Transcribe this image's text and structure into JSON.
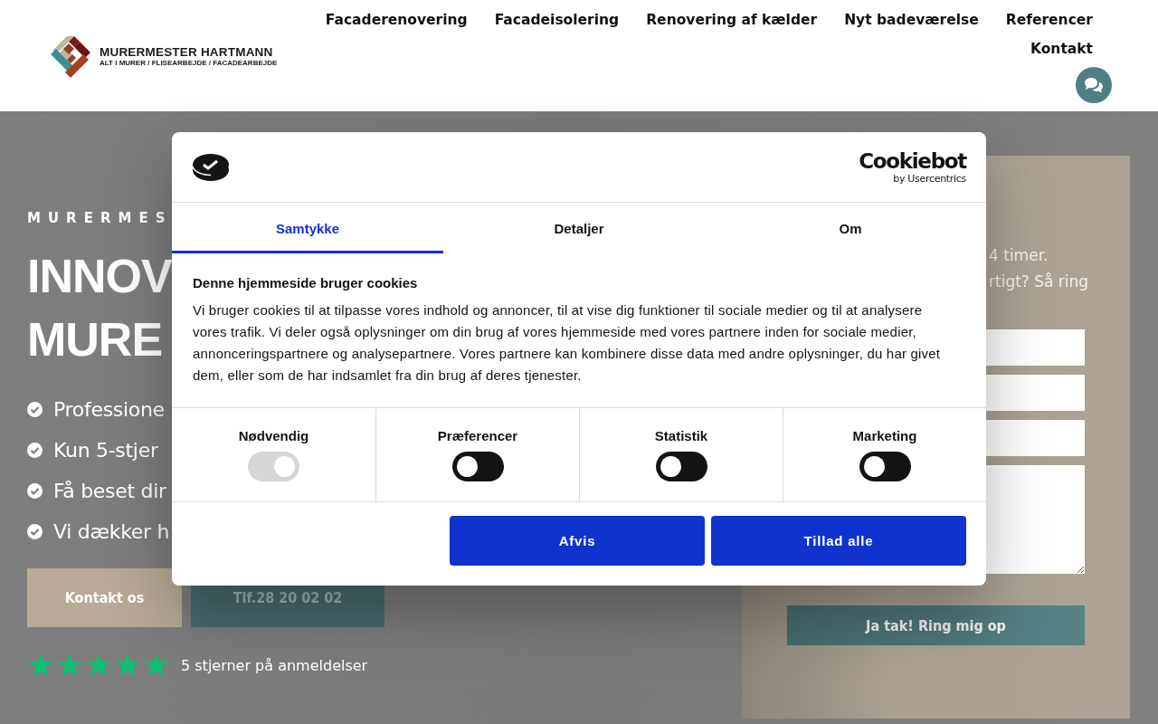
{
  "header": {
    "logo": {
      "name": "MURERMESTER HARTMANN",
      "tagline": "ALT I MURER / FLISEARBEJDE / FACADEARBEJDE"
    },
    "nav": [
      "Facaderenovering",
      "Facadeisolering",
      "Renovering af kælder",
      "Nyt badeværelse",
      "Referencer",
      "Kontakt"
    ]
  },
  "hero": {
    "eyebrow": "MURERMES",
    "heading_lines": [
      "INNOV",
      "MURE"
    ],
    "bullets": [
      "Professione",
      "Kun 5-stjer",
      "Få beset dir",
      "Vi dækker h"
    ],
    "buttons": [
      {
        "label": "Kontakt os",
        "kind": "primary"
      },
      {
        "label": "Tlf.28 20 02 02",
        "kind": "phone"
      }
    ],
    "rating": {
      "stars": 5,
      "text": "5 stjerner på anmeldelser"
    }
  },
  "callback_panel": {
    "intro_lines": [
      "4 timer.",
      "rtigt? Så ring"
    ],
    "fields": [
      {
        "kind": "input"
      },
      {
        "kind": "input"
      },
      {
        "kind": "input"
      },
      {
        "kind": "textarea"
      }
    ],
    "button": "Ja tak! Ring mig op"
  },
  "consent": {
    "logo": {
      "name": "Cookiebot",
      "byline": "by Usercentrics"
    },
    "tabs": [
      {
        "label": "Samtykke",
        "selected": true
      },
      {
        "label": "Detaljer",
        "selected": false
      },
      {
        "label": "Om",
        "selected": false
      }
    ],
    "title": "Denne hjemmeside bruger cookies",
    "text": "Vi bruger cookies til at tilpasse vores indhold og annoncer, til at vise dig funktioner til sociale medier og til at analysere vores trafik. Vi deler også oplysninger om din brug af vores hjemmeside med vores partnere inden for sociale medier, annonceringspartnere og analysepartnere. Vores partnere kan kombinere disse data med andre oplysninger, du har givet dem, eller som de har indsamlet fra din brug af deres tjenester.",
    "toggles": [
      {
        "label": "Nødvendig",
        "checked": true,
        "disabled": true
      },
      {
        "label": "Præferencer",
        "checked": false,
        "disabled": false
      },
      {
        "label": "Statistik",
        "checked": false,
        "disabled": false
      },
      {
        "label": "Marketing",
        "checked": false,
        "disabled": false
      }
    ],
    "buttons": [
      "Afvis",
      "Tillad alle"
    ]
  }
}
